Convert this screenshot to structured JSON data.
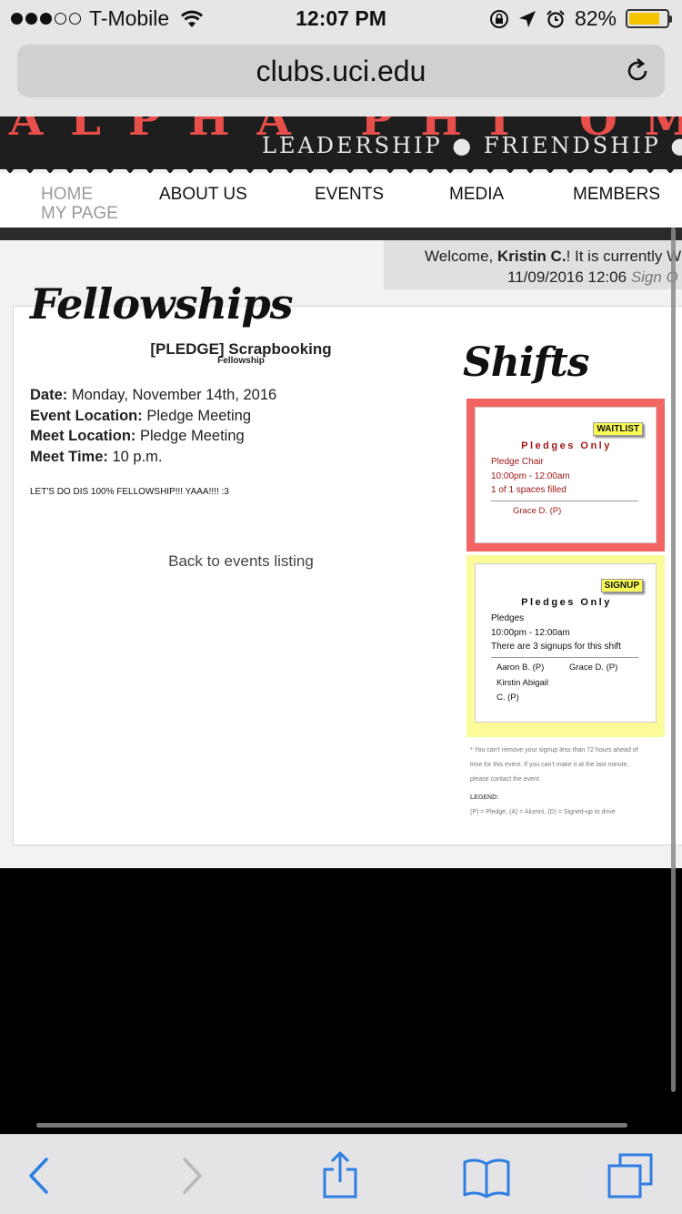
{
  "status_bar": {
    "carrier": "T-Mobile",
    "time": "12:07 PM",
    "battery": "82%",
    "battery_level": 0.82
  },
  "browser": {
    "url": "clubs.uci.edu"
  },
  "site": {
    "tagline": "LEADERSHIP ● FRIENDSHIP ● SERVIC",
    "nav": {
      "home": "HOME",
      "my_page": "MY PAGE",
      "about": "ABOUT US",
      "events": "EVENTS",
      "media": "MEDIA",
      "members": "MEMBERS"
    },
    "welcome": {
      "prefix": "Welcome, ",
      "name": "Kristin C.",
      "suffix": "! It is currently W",
      "datetime": "11/09/2016 12:06 ",
      "sign_out": "Sign O"
    }
  },
  "page": {
    "heading": "Fellowships",
    "event": {
      "title": "[PLEDGE] Scrapbooking",
      "type": "Fellowship",
      "date_label": "Date:",
      "date": "Monday, November 14th, 2016",
      "location_label": "Event Location:",
      "location": "Pledge Meeting",
      "meet_label": "Meet Location:",
      "meet": "Pledge Meeting",
      "time_label": "Meet Time:",
      "time": "10 p.m.",
      "description": "LET'S DO DIS 100% FELLOWSHIP!!! YAAA!!!! :3"
    },
    "back_link": "Back to events listing"
  },
  "shifts": {
    "heading": "Shifts",
    "items": [
      {
        "tag": "WAITLIST",
        "title": "Pledges Only",
        "role": "Pledge Chair",
        "time": "10:00pm - 12:00am",
        "status": "1 of 1 spaces filled",
        "people": [
          "Grace D. (P)"
        ]
      },
      {
        "tag": "SIGNUP",
        "title": "Pledges Only",
        "role": "Pledges",
        "time": "10:00pm - 12:00am",
        "status": "There are 3 signups for this shift",
        "people": [
          "Aaron B. (P)",
          "Grace D. (P)",
          "Kirstin Abigail",
          "C. (P)"
        ]
      }
    ],
    "note_l1": "* You can't remove your signup less than 72 hours ahead of",
    "note_l2": "time for this event. If you can't make it at the last minute,",
    "note_l3": "please contact the event .",
    "legend_label": "LEGEND:",
    "legend": "(P) = Pledge, (A) = Alumni, (D) = Signed-up to drive"
  },
  "colors": {
    "waitlist_box": "#f26563",
    "signup_box": "#fbfb9a",
    "tag": "#fbfb55",
    "waitlist_text": "#a01616",
    "ios_blue": "#2f7de1"
  },
  "icons": [
    "signal-dots-icon",
    "wifi-icon",
    "rotation-lock-icon",
    "location-icon",
    "alarm-icon",
    "battery-icon",
    "reload-icon",
    "back-icon",
    "forward-icon",
    "share-icon",
    "bookmarks-icon",
    "tabs-icon"
  ]
}
